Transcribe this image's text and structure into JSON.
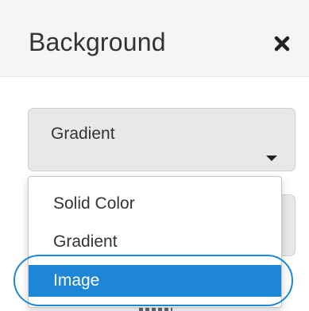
{
  "panel": {
    "title": "Background",
    "close_icon": "close-icon"
  },
  "background_type": {
    "selected": "Gradient",
    "options": [
      "Solid Color",
      "Gradient",
      "Image"
    ],
    "highlighted": "Image",
    "caret_icon": "caret-down-icon"
  },
  "colors": {
    "accent": "#1e86d6",
    "select_bg": "#e8e8e8",
    "header_bg": "#f5f5f5",
    "text": "#333333"
  }
}
